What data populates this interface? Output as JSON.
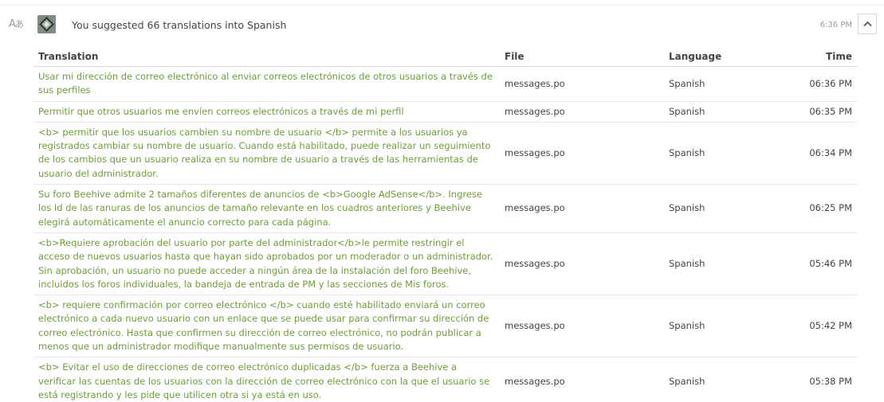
{
  "header": {
    "translate_icon": "translate-icon",
    "title": "You suggested 66 translations into Spanish",
    "time": "6:36 PM",
    "collapse_icon": "chevron-up-icon"
  },
  "table": {
    "columns": {
      "translation": "Translation",
      "file": "File",
      "language": "Language",
      "time": "Time"
    },
    "rows": [
      {
        "translation": "Usar mi dirección de correo electrónico al enviar correos electrónicos de otros usuarios a través de sus perfiles",
        "file": "messages.po",
        "language": "Spanish",
        "time": "06:36 PM"
      },
      {
        "translation": "Permitir que otros usuarios me envíen correos electrónicos a través de mi perfil",
        "file": "messages.po",
        "language": "Spanish",
        "time": "06:35 PM"
      },
      {
        "translation": "<b> permitir que los usuarios cambien su nombre de usuario </b> permite a los usuarios ya registrados cambiar su nombre de usuario. Cuando está habilitado, puede realizar un seguimiento de los cambios que un usuario realiza en su nombre de usuario a través de las herramientas de usuario del administrador.",
        "file": "messages.po",
        "language": "Spanish",
        "time": "06:34 PM"
      },
      {
        "translation": "Su foro Beehive admite 2 tamaños diferentes de anuncios de <b>Google AdSense</b>. Ingrese los Id de las ranuras de los anuncios de tamaño relevante en los cuadros anteriores y Beehive elegirá automáticamente el anuncio correcto para cada página.",
        "file": "messages.po",
        "language": "Spanish",
        "time": "06:25 PM"
      },
      {
        "translation": "<b>Requiere aprobación del usuario por parte del administrador</b>le permite restringir el acceso de nuevos usuarios hasta que hayan sido aprobados por un moderador o un administrador. Sin aprobación, un usuario no puede acceder a ningún área de la instalación del foro Beehive, incluidos los foros individuales, la bandeja de entrada de PM y las secciones de Mis foros.",
        "file": "messages.po",
        "language": "Spanish",
        "time": "05:46 PM"
      },
      {
        "translation": "<b> requiere confirmación por correo electrónico </b> cuando esté habilitado enviará un correo electrónico a cada nuevo usuario con un enlace que se puede usar para confirmar su dirección de correo electrónico. Hasta que confirmen su dirección de correo electrónico, no podrán publicar a menos que un administrador modifique manualmente sus permisos de usuario.",
        "file": "messages.po",
        "language": "Spanish",
        "time": "05:42 PM"
      },
      {
        "translation": "<b> Evitar el uso de direcciones de correo electrónico duplicadas </b> fuerza a Beehive a verificar las cuentas de los usuarios con la dirección de correo electrónico con la que el usuario se está registrando y les pide que utilicen otra si ya está en uso.",
        "file": "messages.po",
        "language": "Spanish",
        "time": "05:38 PM"
      }
    ]
  }
}
